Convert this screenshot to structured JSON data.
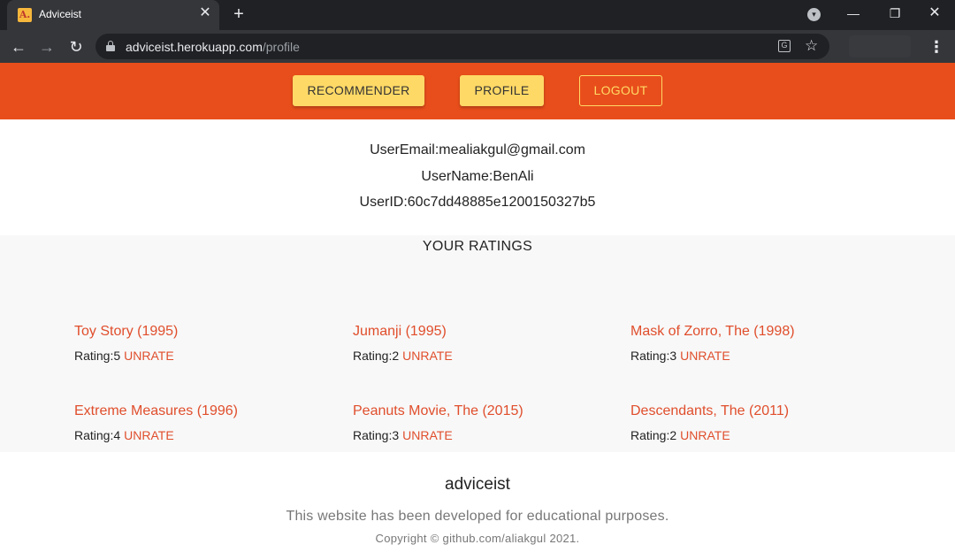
{
  "browser": {
    "tab_title": "Adviceist",
    "favicon_letter": "A.",
    "url_host": "adviceist.herokuapp.com",
    "url_path": "/profile",
    "icons": [
      "back-arrow-icon",
      "forward-arrow-icon",
      "reload-icon",
      "lock-icon",
      "translate-icon",
      "star-icon",
      "menu-icon"
    ]
  },
  "header": {
    "bg_color": "#e84e1b",
    "accent_color": "#ffd966",
    "nav": {
      "recommender": "RECOMMENDER",
      "profile": "PROFILE",
      "logout": "LOGOUT"
    }
  },
  "user": {
    "email_line": "UserEmail:mealiakgul@gmail.com",
    "name_line": "UserName:BenAli",
    "id_line": "UserID:60c7dd48885e1200150327b5"
  },
  "ratings": {
    "heading": "YOUR RATINGS",
    "unrate_label": "UNRATE",
    "items": [
      {
        "title": "Toy Story (1995)",
        "rating": "Rating:5"
      },
      {
        "title": "Jumanji (1995)",
        "rating": "Rating:2"
      },
      {
        "title": "Mask of Zorro, The (1998)",
        "rating": "Rating:3"
      },
      {
        "title": "Extreme Measures (1996)",
        "rating": "Rating:4"
      },
      {
        "title": "Peanuts Movie, The (2015)",
        "rating": "Rating:3"
      },
      {
        "title": "Descendants, The (2011)",
        "rating": "Rating:2"
      }
    ]
  },
  "footer": {
    "brand": "adviceist",
    "note": "This website has been developed for educational purposes.",
    "copyright": "Copyright © github.com/aliakgul 2021."
  }
}
